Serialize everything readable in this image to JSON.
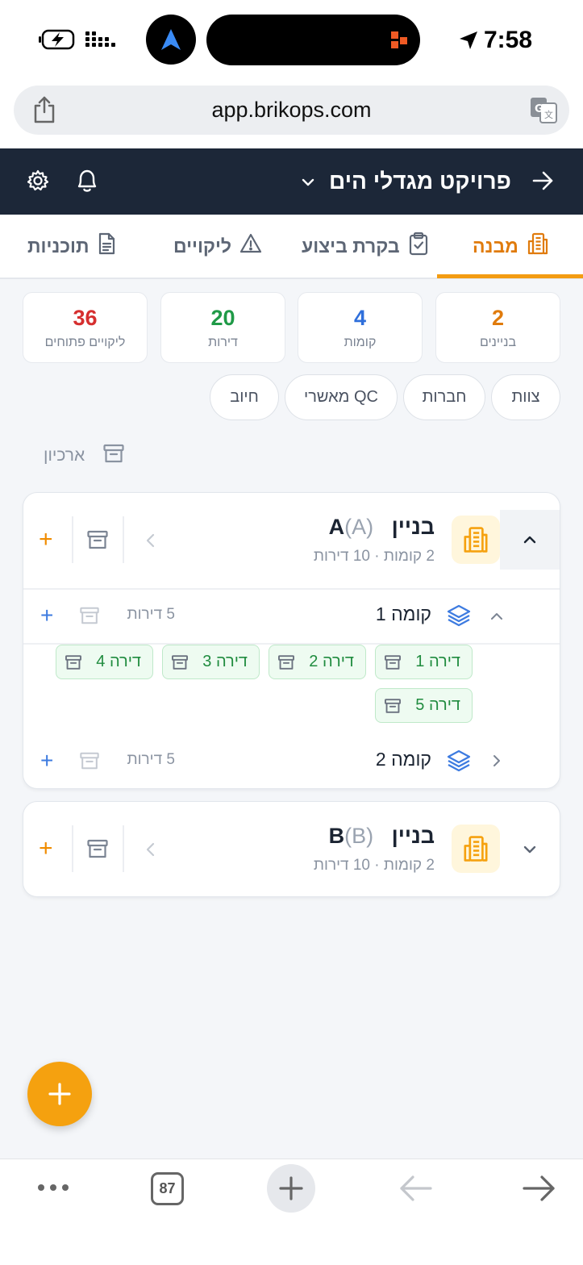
{
  "status_bar": {
    "time": "7:58"
  },
  "browser": {
    "url": "app.brikops.com",
    "tab_count": "87"
  },
  "header": {
    "project_title": "פרויקט מגדלי הים"
  },
  "tabs": [
    {
      "label": "מבנה",
      "icon": "building-icon",
      "active": true
    },
    {
      "label": "בקרת ביצוע",
      "icon": "clipboard-check-icon",
      "active": false
    },
    {
      "label": "ליקויים",
      "icon": "warning-icon",
      "active": false
    },
    {
      "label": "תוכניות",
      "icon": "document-icon",
      "active": false
    }
  ],
  "stats": [
    {
      "value": "2",
      "label": "בניינים",
      "color": "#e07b0c"
    },
    {
      "value": "4",
      "label": "קומות",
      "color": "#2f6fdb"
    },
    {
      "value": "20",
      "label": "דירות",
      "color": "#1f9a47"
    },
    {
      "value": "36",
      "label": "ליקויים פתוחים",
      "color": "#d62f2f"
    }
  ],
  "chips": [
    "צוות",
    "חברות",
    "מאשרי QC",
    "חיוב"
  ],
  "archive_label": "ארכיון",
  "buildings": [
    {
      "name": "בניין",
      "code": "A",
      "paren_code": "(A)",
      "subtitle": "2 קומות · 10 דירות",
      "expanded": true,
      "floors": [
        {
          "label": "קומה 1",
          "count": "5 דירות",
          "expanded": true,
          "apartments": [
            "דירה 1",
            "דירה 2",
            "דירה 3",
            "דירה 4",
            "דירה 5"
          ]
        },
        {
          "label": "קומה 2",
          "count": "5 דירות",
          "expanded": false
        }
      ]
    },
    {
      "name": "בניין",
      "code": "B",
      "paren_code": "(B)",
      "subtitle": "2 קומות · 10 דירות",
      "expanded": false
    }
  ],
  "colors": {
    "accent": "#f5a10f",
    "header_bg": "#1c2738",
    "apartment_green": "#208c3f",
    "blue": "#3d7be0"
  }
}
